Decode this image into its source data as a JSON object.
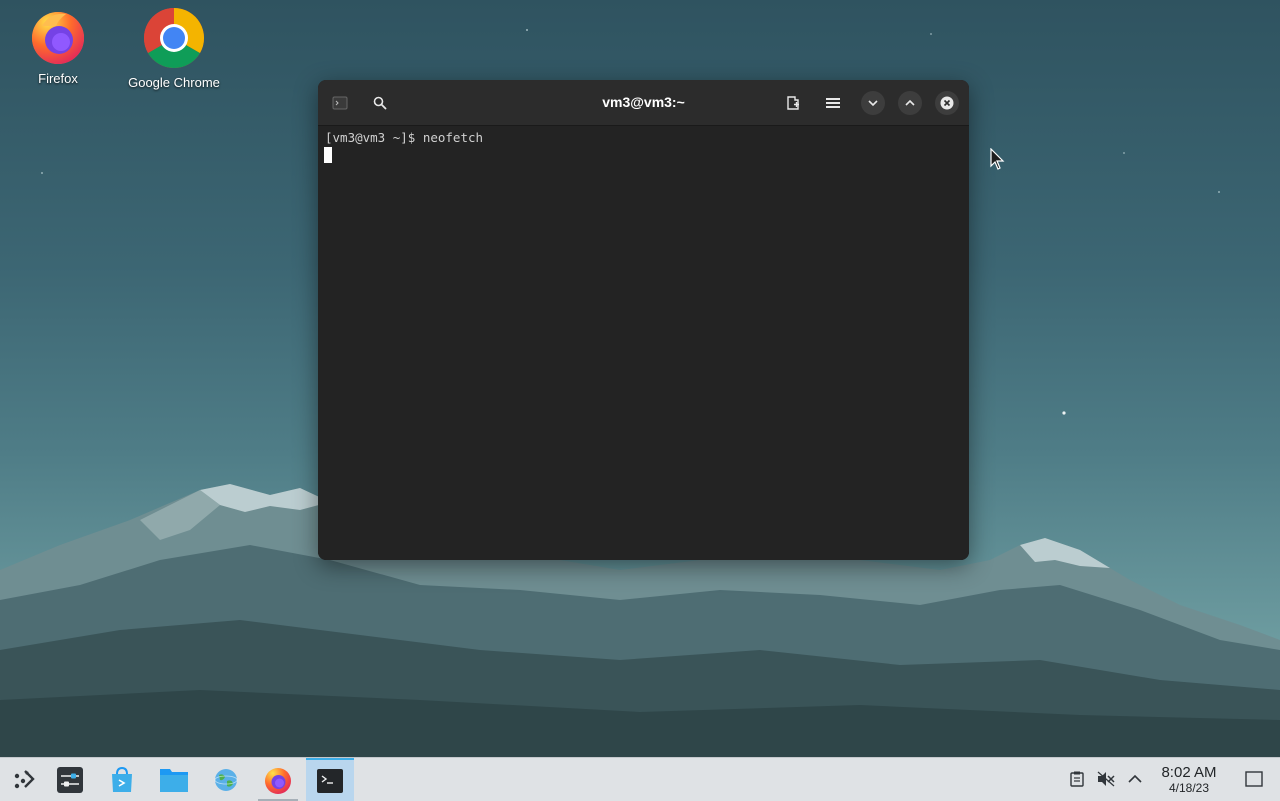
{
  "desktop": {
    "icons": [
      {
        "label": "Firefox",
        "icon": "firefox-icon"
      },
      {
        "label": "Google Chrome",
        "icon": "chrome-icon"
      }
    ]
  },
  "terminal": {
    "title": "vm3@vm3:~",
    "prompt": "[vm3@vm3 ~]$ neofetch",
    "buttons": [
      "terminal-menu-icon",
      "search-icon",
      "new-tab-icon",
      "hamburger-menu-icon",
      "minimize-icon",
      "maximize-icon",
      "close-icon"
    ]
  },
  "taskbar": {
    "items": [
      {
        "name": "app-launcher",
        "icon": "app-launcher-icon"
      },
      {
        "name": "system-settings",
        "icon": "settings-icon"
      },
      {
        "name": "discover",
        "icon": "store-icon"
      },
      {
        "name": "dolphin",
        "icon": "folder-icon"
      },
      {
        "name": "network",
        "icon": "globe-icon"
      },
      {
        "name": "firefox",
        "icon": "firefox-icon"
      },
      {
        "name": "konsole",
        "icon": "terminal-icon"
      }
    ],
    "tray": [
      "clipboard-icon",
      "volume-muted-icon",
      "tray-expand-icon"
    ],
    "clock": {
      "time": "8:02 AM",
      "date": "4/18/23"
    }
  },
  "colors": {
    "terminal_bg": "#232323",
    "titlebar_bg": "#2c2c2c",
    "taskbar_bg": "#dfe2e5",
    "accent": "#3daee9"
  }
}
